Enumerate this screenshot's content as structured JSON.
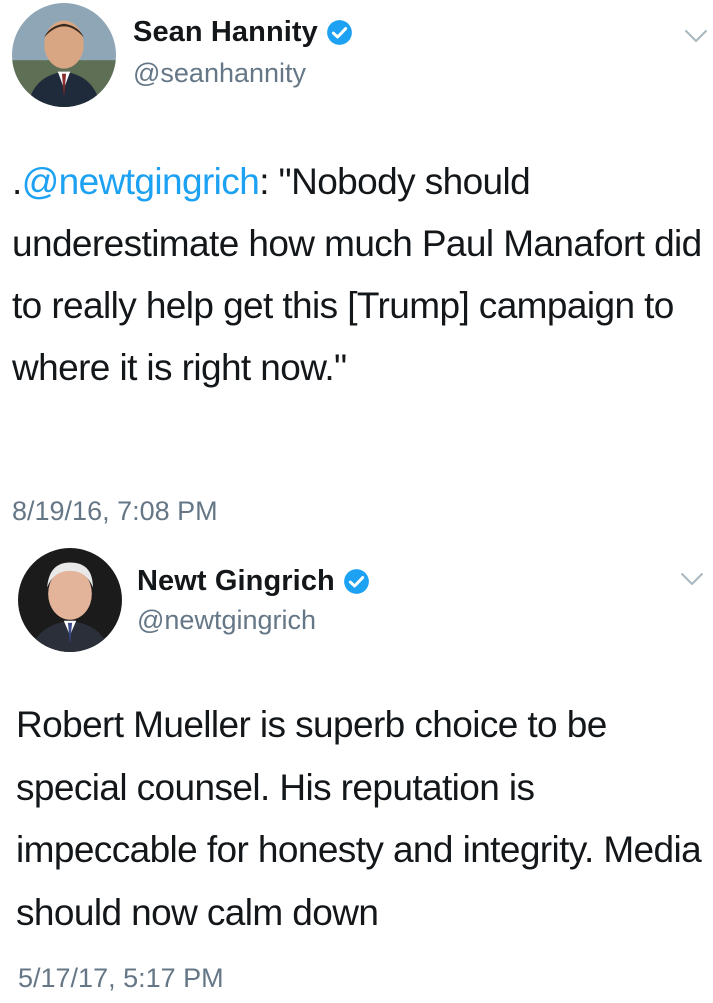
{
  "tweets": [
    {
      "display_name": "Sean Hannity",
      "handle": "@seanhannity",
      "text_prefix": ".",
      "mention": "@newtgingrich",
      "text_rest": ": \"Nobody should underestimate how much Paul Manafort did to really help get this [Trump] campaign to where it is right now.\"",
      "timestamp": "8/19/16, 7:08 PM",
      "avatar_icon": "user-avatar-icon",
      "verified_icon": "verified-badge-icon",
      "menu_icon": "chevron-down-icon"
    },
    {
      "display_name": "Newt Gingrich",
      "handle": "@newtgingrich",
      "text": "Robert Mueller is superb choice to be special counsel. His reputation is impeccable for honesty and integrity. Media should now calm down",
      "timestamp": "5/17/17, 5:17 PM",
      "avatar_icon": "user-avatar-icon",
      "verified_icon": "verified-badge-icon",
      "menu_icon": "chevron-down-icon"
    }
  ],
  "colors": {
    "text": "#14171a",
    "secondary": "#657786",
    "link": "#1da1f2",
    "verified": "#1da1f2"
  }
}
